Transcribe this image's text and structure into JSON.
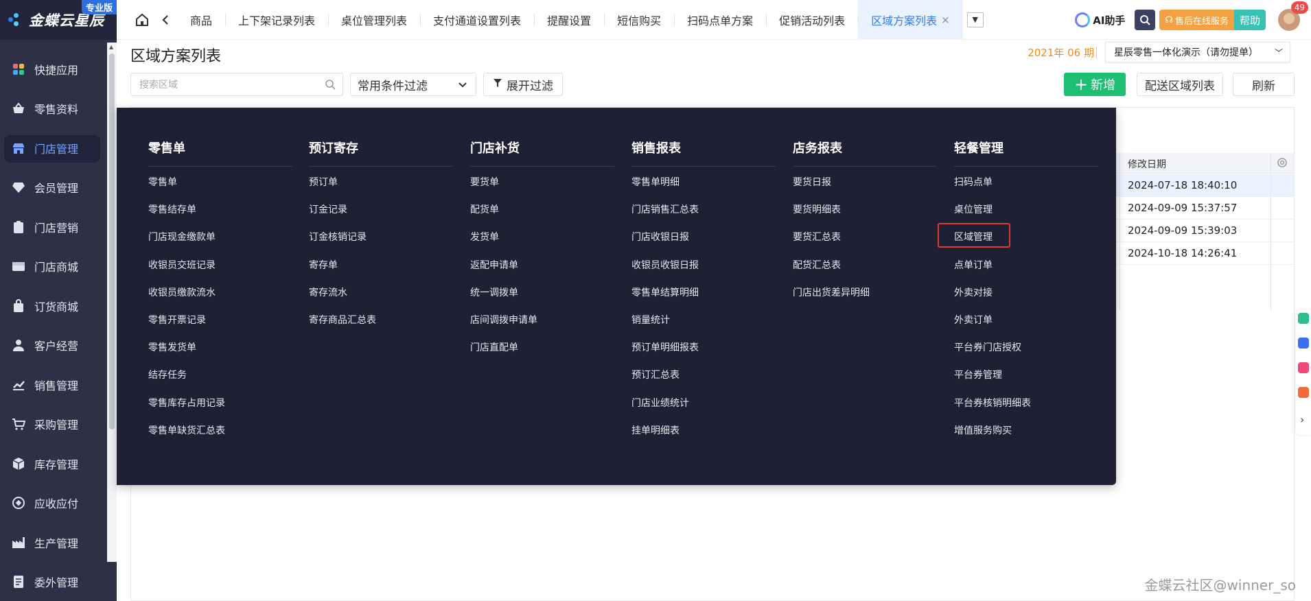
{
  "brand": {
    "name": "金蝶云星辰",
    "edition": "专业版"
  },
  "sidebar": {
    "items": [
      {
        "label": "快捷应用",
        "icon": "apps-icon"
      },
      {
        "label": "零售资料",
        "icon": "basket-icon"
      },
      {
        "label": "门店管理",
        "icon": "store-icon",
        "active": true
      },
      {
        "label": "会员管理",
        "icon": "diamond-icon"
      },
      {
        "label": "门店营销",
        "icon": "tag-icon"
      },
      {
        "label": "门店商城",
        "icon": "shop-icon"
      },
      {
        "label": "订货商城",
        "icon": "bag-icon"
      },
      {
        "label": "客户经营",
        "icon": "user-icon"
      },
      {
        "label": "销售管理",
        "icon": "chart-icon"
      },
      {
        "label": "采购管理",
        "icon": "cart-icon"
      },
      {
        "label": "库存管理",
        "icon": "box-icon"
      },
      {
        "label": "应收应付",
        "icon": "coin-icon"
      },
      {
        "label": "生产管理",
        "icon": "factory-icon"
      },
      {
        "label": "委外管理",
        "icon": "list-icon"
      }
    ]
  },
  "tabs": [
    {
      "label": "商品"
    },
    {
      "label": "上下架记录列表"
    },
    {
      "label": "桌位管理列表"
    },
    {
      "label": "支付通道设置列表"
    },
    {
      "label": "提醒设置"
    },
    {
      "label": "短信购买"
    },
    {
      "label": "扫码点单方案"
    },
    {
      "label": "促销活动列表"
    },
    {
      "label": "区域方案列表",
      "active": true,
      "close": "×"
    }
  ],
  "topright": {
    "ai": "AI助手",
    "service": "售后在线服务",
    "help": "帮助",
    "badge": "49"
  },
  "page": {
    "title": "区域方案列表",
    "period": "2021年 06 期",
    "org": "星辰零售一体化演示（请勿提单）"
  },
  "toolbar": {
    "search_placeholder": "搜索区域",
    "filter": "常用条件过滤",
    "expand": "展开过滤",
    "new": "新增",
    "send": "配送区域列表",
    "refresh": "刷新"
  },
  "table": {
    "header": "修改日期",
    "rows": [
      "2024-07-18 18:40:10",
      "2024-09-09 15:37:57",
      "2024-09-09 15:39:03",
      "2024-10-18 14:26:41"
    ]
  },
  "mega": {
    "columns": [
      {
        "title": "零售单",
        "items": [
          "零售单",
          "零售结存单",
          "门店现金缴款单",
          "收银员交班记录",
          "收银员缴款流水",
          "零售开票记录",
          "零售发货单",
          "结存任务",
          "零售库存占用记录",
          "零售单缺货汇总表"
        ]
      },
      {
        "title": "预订寄存",
        "items": [
          "预订单",
          "订金记录",
          "订金核销记录",
          "寄存单",
          "寄存流水",
          "寄存商品汇总表"
        ]
      },
      {
        "title": "门店补货",
        "items": [
          "要货单",
          "配货单",
          "发货单",
          "返配申请单",
          "统一调拨单",
          "店间调拨申请单",
          "门店直配单"
        ]
      },
      {
        "title": "销售报表",
        "items": [
          "零售单明细",
          "门店销售汇总表",
          "门店收银日报",
          "收银员收银日报",
          "零售单结算明细",
          "销量统计",
          "预订单明细报表",
          "预订汇总表",
          "门店业绩统计",
          "挂单明细表"
        ]
      },
      {
        "title": "店务报表",
        "items": [
          "要货日报",
          "要货明细表",
          "要货汇总表",
          "配货汇总表",
          "门店出货差异明细"
        ]
      },
      {
        "title": "轻餐管理",
        "items": [
          "扫码点单",
          "桌位管理",
          "区域管理",
          "点单订单",
          "外卖对接",
          "外卖订单",
          "平台券门店授权",
          "平台券管理",
          "平台券核销明细表",
          "增值服务购买"
        ]
      }
    ]
  },
  "watermark": "金蝶云社区@winner_so",
  "colors": {
    "sidebar": "#2e3145",
    "mega": "#1f2033",
    "accent": "#2d7cf6",
    "new": "#1dbf73",
    "highlight": "#e23a2c"
  }
}
